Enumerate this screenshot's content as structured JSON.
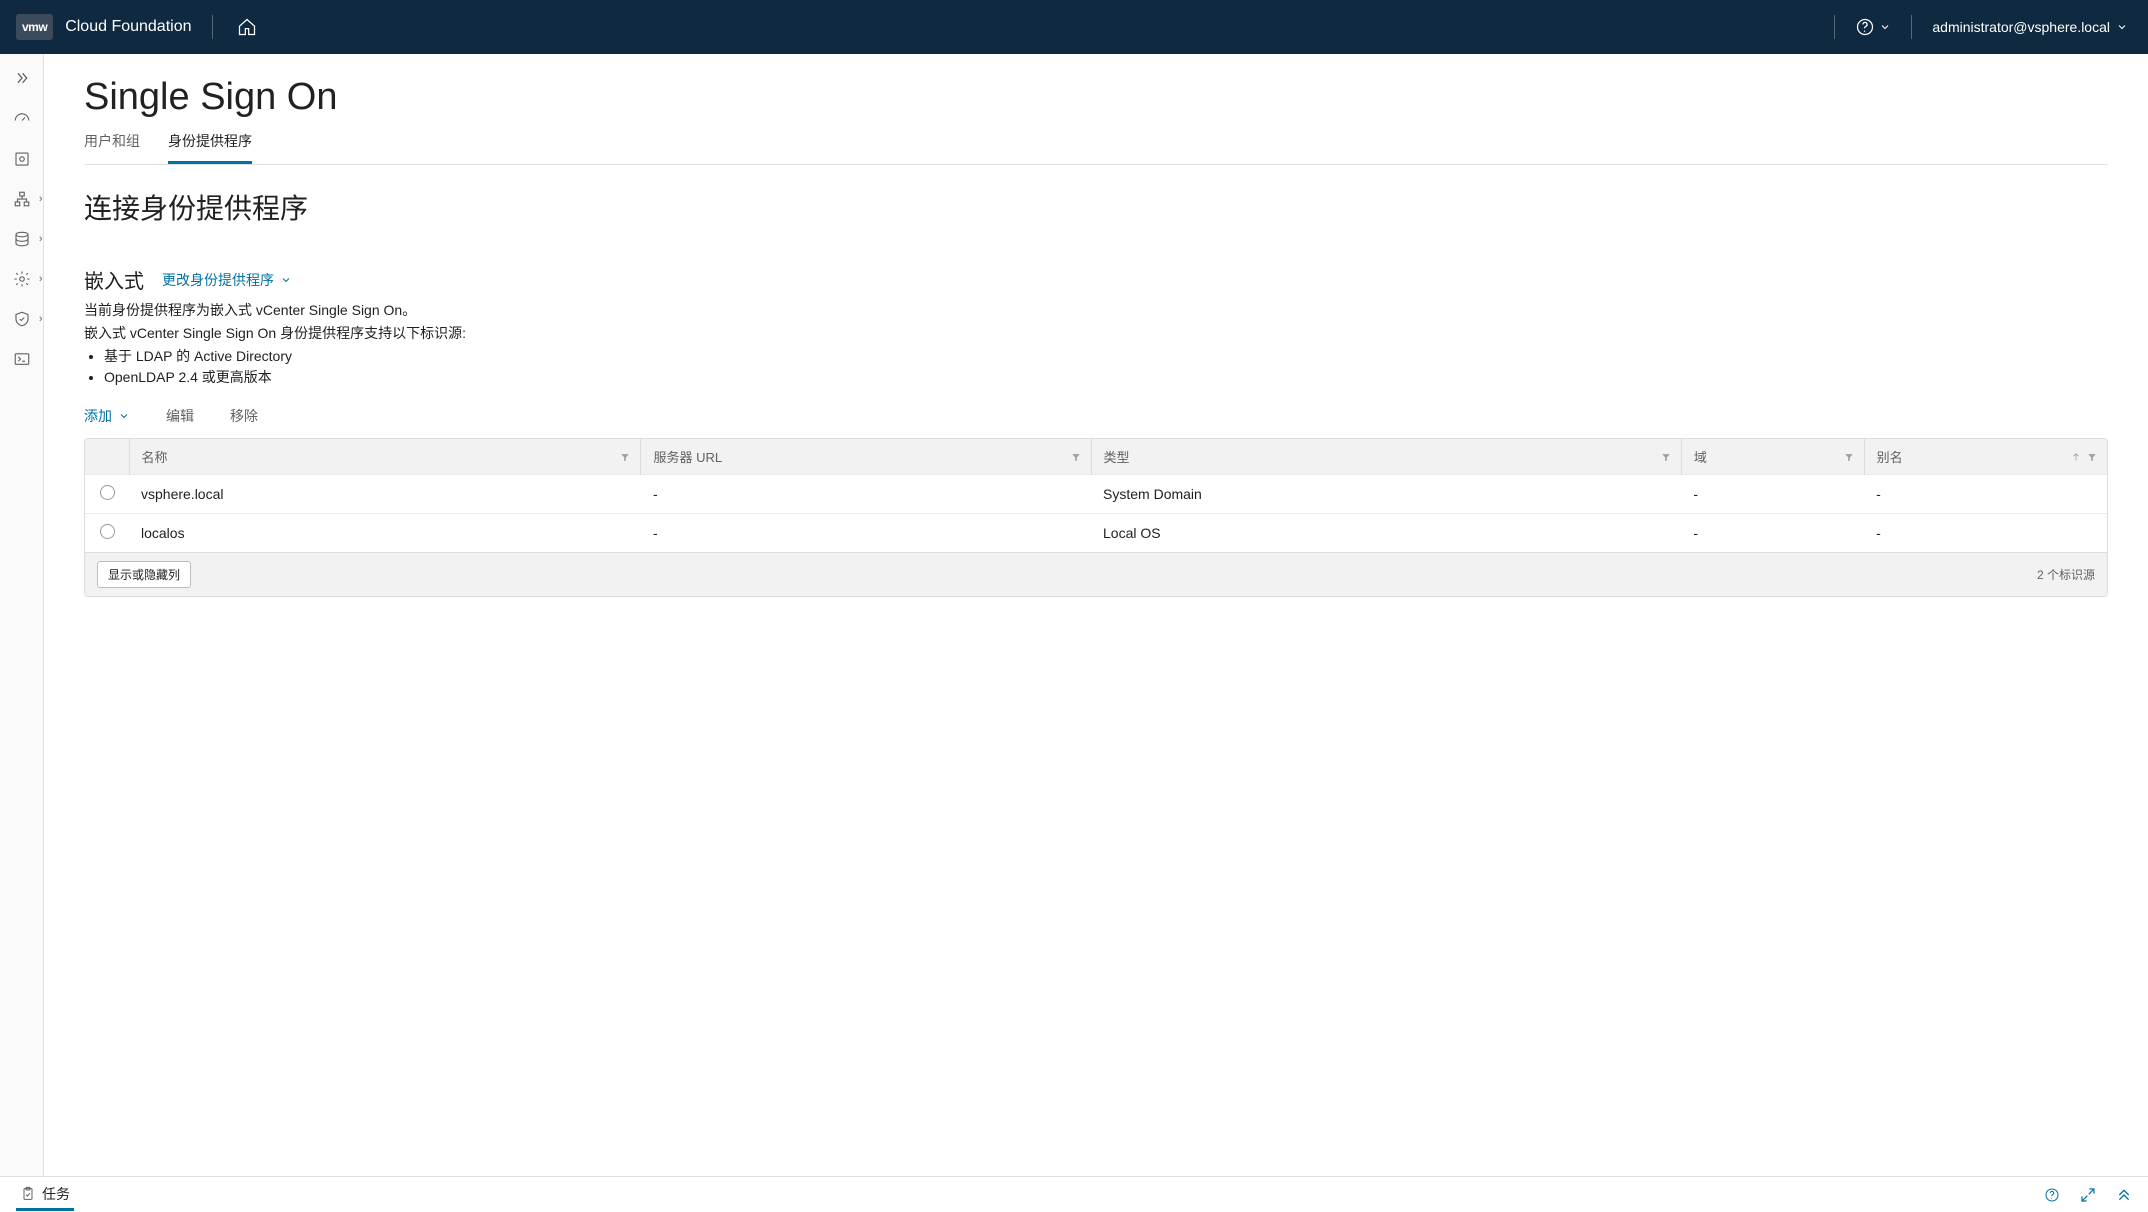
{
  "header": {
    "logo": "vmw",
    "product": "Cloud Foundation",
    "user": "administrator@vsphere.local"
  },
  "page": {
    "title": "Single Sign On",
    "tabs": [
      {
        "label": "用户和组",
        "active": false
      },
      {
        "label": "身份提供程序",
        "active": true
      }
    ],
    "section_title": "连接身份提供程序",
    "embedded_label": "嵌入式",
    "change_provider": "更改身份提供程序",
    "desc_line1": "当前身份提供程序为嵌入式 vCenter Single Sign On。",
    "desc_line2": "嵌入式 vCenter Single Sign On 身份提供程序支持以下标识源:",
    "supported": [
      "基于 LDAP 的 Active Directory",
      "OpenLDAP 2.4 或更高版本"
    ],
    "toolbar": {
      "add": "添加",
      "edit": "编辑",
      "remove": "移除"
    },
    "table": {
      "columns": {
        "name": "名称",
        "server_url": "服务器 URL",
        "type": "类型",
        "domain": "域",
        "alias": "别名"
      },
      "rows": [
        {
          "name": "vsphere.local",
          "server_url": "-",
          "type": "System Domain",
          "domain": "-",
          "alias": "-"
        },
        {
          "name": "localos",
          "server_url": "-",
          "type": "Local OS",
          "domain": "-",
          "alias": "-"
        }
      ],
      "col_toggle": "显示或隐藏列",
      "count": "2 个标识源"
    }
  },
  "footer": {
    "tasks": "任务"
  }
}
